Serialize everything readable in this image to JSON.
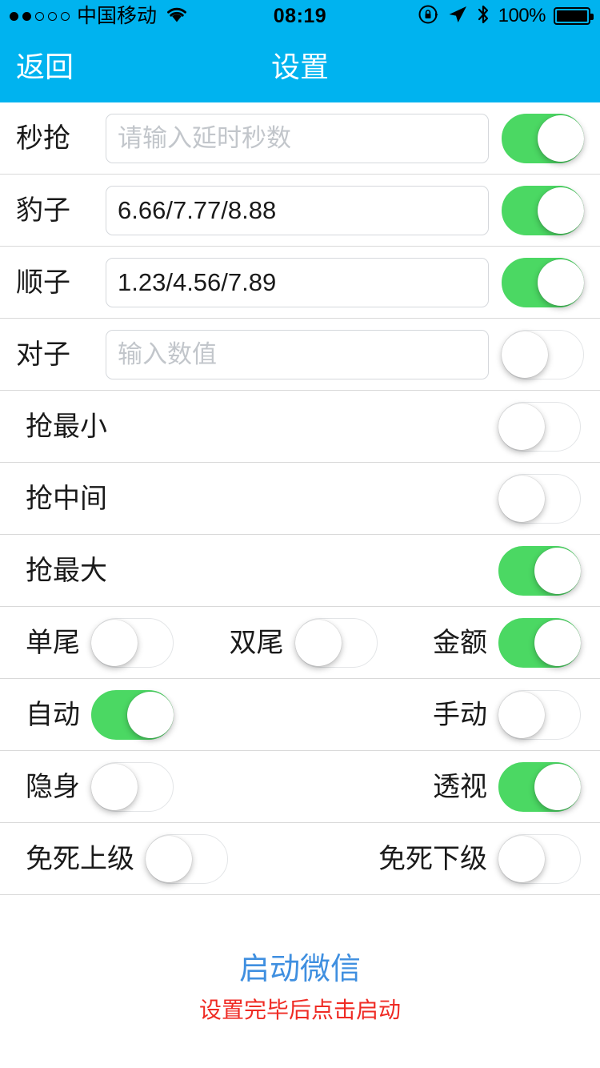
{
  "status_bar": {
    "signal_dots_filled": 2,
    "signal_dots_total": 5,
    "carrier": "中国移动",
    "wifi_icon": "wifi-icon",
    "time": "08:19",
    "rotation_lock_icon": "rotation-lock-icon",
    "location_icon": "location-arrow-icon",
    "bluetooth_icon": "bluetooth-icon",
    "battery_percent": "100%",
    "battery_icon": "battery-full-icon"
  },
  "nav": {
    "back_label": "返回",
    "title": "设置",
    "background_color": "#00b3ef",
    "text_color": "#ffffff"
  },
  "colors": {
    "switch_on": "#4bd863",
    "switch_off_track": "#ffffff",
    "switch_off_border": "#e3e5e7",
    "separator": "#d9d9d9",
    "link_blue": "#3f8fe0",
    "hint_red": "#ef2b24",
    "placeholder_gray": "#c2c6cb"
  },
  "rows": [
    {
      "type": "input",
      "name": "miaoqiang",
      "label": "秒抢",
      "value": "",
      "placeholder": "请输入延时秒数",
      "switch_on": true
    },
    {
      "type": "input",
      "name": "baozi",
      "label": "豹子",
      "value": "6.66/7.77/8.88",
      "placeholder": "",
      "switch_on": true
    },
    {
      "type": "input",
      "name": "shunzi",
      "label": "顺子",
      "value": "1.23/4.56/7.89",
      "placeholder": "",
      "switch_on": true
    },
    {
      "type": "input",
      "name": "duizi",
      "label": "对子",
      "value": "",
      "placeholder": "输入数值",
      "switch_on": false
    },
    {
      "type": "single",
      "name": "qiang-zui-xiao",
      "label": "抢最小",
      "switch_on": false
    },
    {
      "type": "single",
      "name": "qiang-zhong-jian",
      "label": "抢中间",
      "switch_on": false
    },
    {
      "type": "single",
      "name": "qiang-zui-da",
      "label": "抢最大",
      "switch_on": true
    },
    {
      "type": "multi",
      "name": "wei-jine-row",
      "items": [
        {
          "name": "dan-wei",
          "label": "单尾",
          "switch_on": false
        },
        {
          "name": "shuang-wei",
          "label": "双尾",
          "switch_on": false
        },
        {
          "name": "jin-e",
          "label": "金额",
          "switch_on": true
        }
      ]
    },
    {
      "type": "multi",
      "name": "auto-manual-row",
      "items": [
        {
          "name": "zi-dong",
          "label": "自动",
          "switch_on": true
        },
        {
          "name": "shou-dong",
          "label": "手动",
          "switch_on": false
        }
      ]
    },
    {
      "type": "multi",
      "name": "stealth-xray-row",
      "items": [
        {
          "name": "yin-shen",
          "label": "隐身",
          "switch_on": false
        },
        {
          "name": "tou-shi",
          "label": "透视",
          "switch_on": true
        }
      ]
    },
    {
      "type": "multi",
      "name": "mian-si-row",
      "items": [
        {
          "name": "mian-si-shang-ji",
          "label": "免死上级",
          "switch_on": false
        },
        {
          "name": "mian-si-xia-ji",
          "label": "免死下级",
          "switch_on": false
        }
      ]
    }
  ],
  "footer": {
    "launch_label": "启动微信",
    "hint": "设置完毕后点击启动"
  }
}
